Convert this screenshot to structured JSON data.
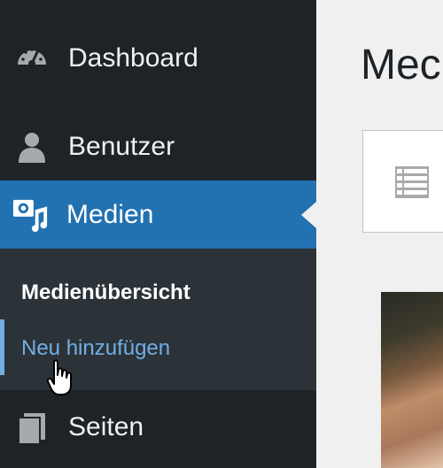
{
  "sidebar": {
    "items": [
      {
        "id": "dashboard",
        "label": "Dashboard",
        "icon": "dashboard-gauge-icon"
      },
      {
        "id": "users",
        "label": "Benutzer",
        "icon": "user-icon"
      },
      {
        "id": "media",
        "label": "Medien",
        "icon": "media-icon",
        "active": true
      },
      {
        "id": "pages",
        "label": "Seiten",
        "icon": "pages-icon"
      }
    ],
    "media_submenu": [
      {
        "label": "Medienübersicht",
        "current": true
      },
      {
        "label": "Neu hinzufügen",
        "hover": true
      }
    ]
  },
  "main": {
    "title": "Mec",
    "view_toggle_icon": "list-view-icon"
  },
  "colors": {
    "sidebar_bg": "#1d2327",
    "submenu_bg": "#2c3338",
    "accent": "#2271b1",
    "link_hover": "#72aee6",
    "content_bg": "#f0f0f1"
  }
}
